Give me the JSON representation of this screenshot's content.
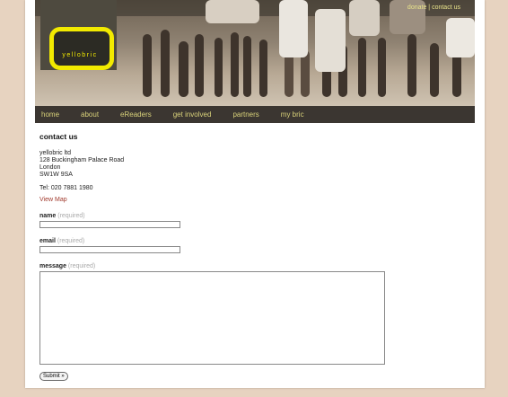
{
  "header": {
    "logo_text": "yellobric",
    "top_links": [
      "donate",
      "contact us"
    ],
    "separator": "|"
  },
  "nav": [
    "home",
    "about",
    "eReaders",
    "get involved",
    "partners",
    "my bric"
  ],
  "page": {
    "title": "contact us",
    "address": [
      "yellobric ltd",
      "128 Buckingham Palace Road",
      "London",
      "SW1W 9SA"
    ],
    "tel": "Tel: 020 7881 1980",
    "map_link": "View Map"
  },
  "form": {
    "name_label": "name",
    "email_label": "email",
    "message_label": "message",
    "required_hint": "(required)",
    "submit_label": "Submit »"
  },
  "colors": {
    "background": "#e7d3c0",
    "nav_bg": "#3b3631",
    "nav_text": "#d9d27a",
    "logo_yellow": "#f2ea00",
    "link_red": "#a0392c"
  }
}
